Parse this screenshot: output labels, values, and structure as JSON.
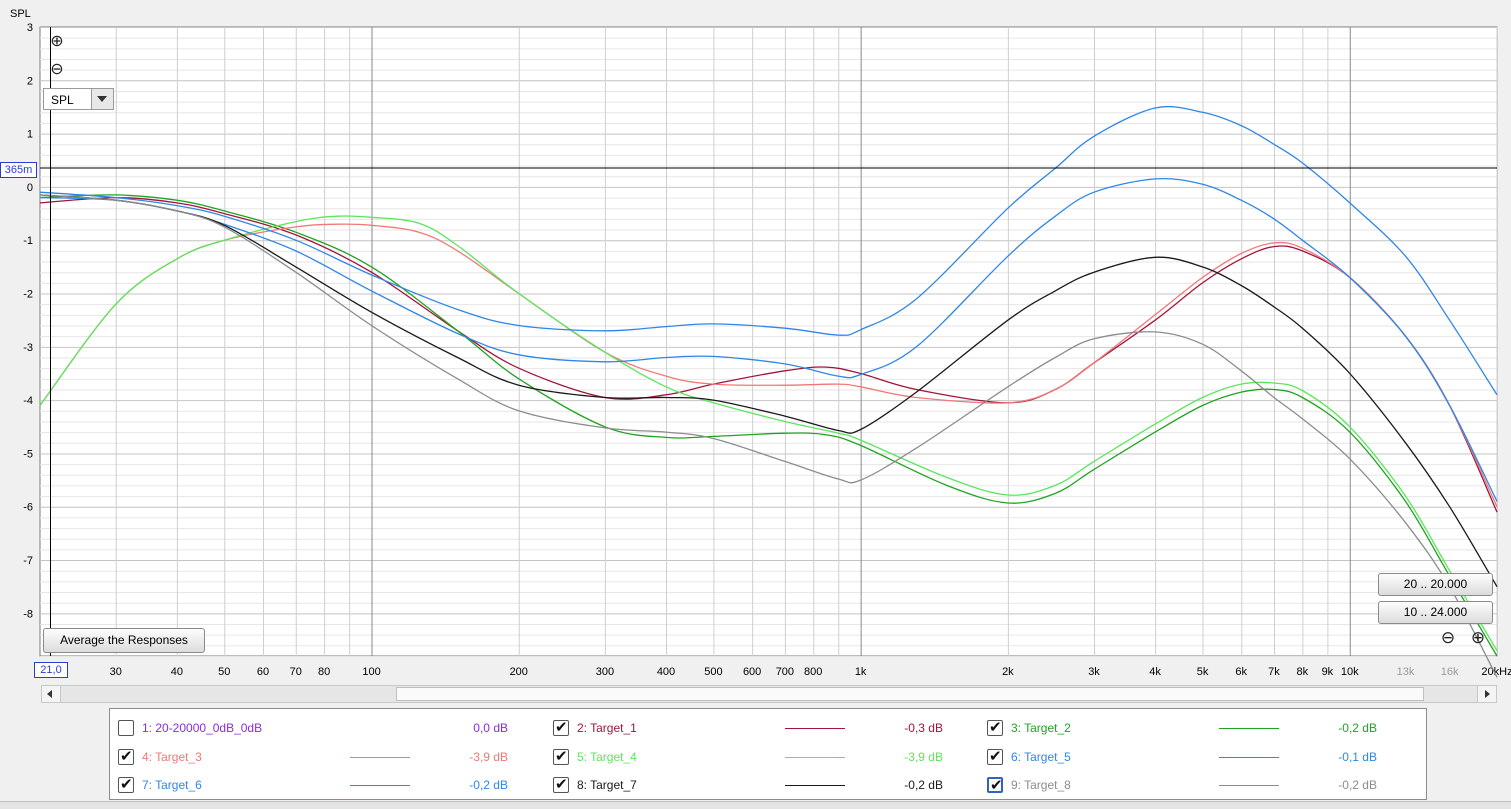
{
  "chart_data": {
    "type": "line",
    "y_axis_label": "SPL",
    "ylim": [
      -8.8,
      3
    ],
    "xlim": [
      21,
      20000
    ],
    "x_scale": "log",
    "grid": true,
    "y_ticks": [
      "3",
      "2",
      "1",
      "0",
      "-1",
      "-2",
      "-3",
      "-4",
      "-5",
      "-6",
      "-7",
      "-8"
    ],
    "x_tick_labels": [
      {
        "f": 30,
        "t": "30"
      },
      {
        "f": 40,
        "t": "40"
      },
      {
        "f": 50,
        "t": "50"
      },
      {
        "f": 60,
        "t": "60"
      },
      {
        "f": 70,
        "t": "70"
      },
      {
        "f": 80,
        "t": "80"
      },
      {
        "f": 100,
        "t": "100"
      },
      {
        "f": 200,
        "t": "200"
      },
      {
        "f": 300,
        "t": "300"
      },
      {
        "f": 400,
        "t": "400"
      },
      {
        "f": 500,
        "t": "500"
      },
      {
        "f": 600,
        "t": "600"
      },
      {
        "f": 700,
        "t": "700"
      },
      {
        "f": 800,
        "t": "800"
      },
      {
        "f": 1000,
        "t": "1k"
      },
      {
        "f": 2000,
        "t": "2k"
      },
      {
        "f": 3000,
        "t": "3k"
      },
      {
        "f": 4000,
        "t": "4k"
      },
      {
        "f": 5000,
        "t": "5k"
      },
      {
        "f": 6000,
        "t": "6k"
      },
      {
        "f": 7000,
        "t": "7k"
      },
      {
        "f": 8000,
        "t": "8k"
      },
      {
        "f": 9000,
        "t": "9k"
      },
      {
        "f": 10000,
        "t": "10k"
      },
      {
        "f": 13000,
        "t": "13k",
        "muted": true
      },
      {
        "f": 16000,
        "t": "16k",
        "muted": true
      },
      {
        "f": 20000,
        "t": "20kHz"
      }
    ],
    "cursor_y_label": "365m",
    "cursor_y_value": 0.365,
    "cursor_x_label": "21,0",
    "series": [
      {
        "name": "Target_1",
        "color": "#a3143a",
        "points": [
          [
            21,
            -0.3
          ],
          [
            30,
            -0.2
          ],
          [
            40,
            -0.3
          ],
          [
            50,
            -0.5
          ],
          [
            70,
            -0.9
          ],
          [
            100,
            -1.6
          ],
          [
            150,
            -2.7
          ],
          [
            200,
            -3.4
          ],
          [
            300,
            -3.95
          ],
          [
            400,
            -3.9
          ],
          [
            500,
            -3.7
          ],
          [
            700,
            -3.45
          ],
          [
            850,
            -3.38
          ],
          [
            1000,
            -3.5
          ],
          [
            1300,
            -3.8
          ],
          [
            2000,
            -4.05
          ],
          [
            2500,
            -3.8
          ],
          [
            3000,
            -3.3
          ],
          [
            4000,
            -2.5
          ],
          [
            5000,
            -1.8
          ],
          [
            6000,
            -1.35
          ],
          [
            7000,
            -1.12
          ],
          [
            8000,
            -1.2
          ],
          [
            10000,
            -1.7
          ],
          [
            13000,
            -2.8
          ],
          [
            16000,
            -4.1
          ],
          [
            20000,
            -6.1
          ]
        ]
      },
      {
        "name": "Target_2",
        "color": "#1fa41f",
        "points": [
          [
            21,
            -0.2
          ],
          [
            30,
            -0.15
          ],
          [
            40,
            -0.25
          ],
          [
            50,
            -0.45
          ],
          [
            70,
            -0.85
          ],
          [
            100,
            -1.5
          ],
          [
            150,
            -2.7
          ],
          [
            200,
            -3.6
          ],
          [
            300,
            -4.5
          ],
          [
            400,
            -4.7
          ],
          [
            500,
            -4.68
          ],
          [
            700,
            -4.62
          ],
          [
            850,
            -4.65
          ],
          [
            1000,
            -4.85
          ],
          [
            1500,
            -5.6
          ],
          [
            2000,
            -5.93
          ],
          [
            2500,
            -5.75
          ],
          [
            3000,
            -5.3
          ],
          [
            4000,
            -4.6
          ],
          [
            5000,
            -4.1
          ],
          [
            6000,
            -3.85
          ],
          [
            7000,
            -3.8
          ],
          [
            8000,
            -3.95
          ],
          [
            10000,
            -4.6
          ],
          [
            13000,
            -5.9
          ],
          [
            16000,
            -7.3
          ],
          [
            20000,
            -8.8
          ]
        ]
      },
      {
        "name": "Target_3",
        "color": "#f07878",
        "points": [
          [
            21,
            -4.1
          ],
          [
            30,
            -2.2
          ],
          [
            40,
            -1.35
          ],
          [
            50,
            -1.0
          ],
          [
            70,
            -0.75
          ],
          [
            85,
            -0.7
          ],
          [
            100,
            -0.72
          ],
          [
            125,
            -0.85
          ],
          [
            150,
            -1.2
          ],
          [
            200,
            -2.0
          ],
          [
            300,
            -3.1
          ],
          [
            400,
            -3.55
          ],
          [
            500,
            -3.7
          ],
          [
            700,
            -3.72
          ],
          [
            900,
            -3.7
          ],
          [
            1000,
            -3.75
          ],
          [
            1300,
            -3.95
          ],
          [
            2000,
            -4.05
          ],
          [
            2500,
            -3.8
          ],
          [
            3000,
            -3.3
          ],
          [
            4000,
            -2.4
          ],
          [
            5000,
            -1.7
          ],
          [
            6000,
            -1.25
          ],
          [
            7000,
            -1.05
          ],
          [
            8000,
            -1.15
          ],
          [
            10000,
            -1.7
          ],
          [
            13000,
            -2.8
          ],
          [
            16000,
            -4.1
          ],
          [
            20000,
            -6.0
          ]
        ]
      },
      {
        "name": "Target_4",
        "color": "#5ce65c",
        "points": [
          [
            21,
            -4.1
          ],
          [
            30,
            -2.2
          ],
          [
            40,
            -1.35
          ],
          [
            50,
            -1.0
          ],
          [
            70,
            -0.65
          ],
          [
            85,
            -0.55
          ],
          [
            100,
            -0.57
          ],
          [
            125,
            -0.68
          ],
          [
            150,
            -1.1
          ],
          [
            200,
            -2.0
          ],
          [
            300,
            -3.1
          ],
          [
            400,
            -3.75
          ],
          [
            500,
            -4.05
          ],
          [
            700,
            -4.4
          ],
          [
            900,
            -4.62
          ],
          [
            1000,
            -4.75
          ],
          [
            1500,
            -5.45
          ],
          [
            2000,
            -5.78
          ],
          [
            2500,
            -5.6
          ],
          [
            3000,
            -5.15
          ],
          [
            4000,
            -4.45
          ],
          [
            5000,
            -3.95
          ],
          [
            6000,
            -3.7
          ],
          [
            7000,
            -3.68
          ],
          [
            8000,
            -3.82
          ],
          [
            10000,
            -4.5
          ],
          [
            13000,
            -5.8
          ],
          [
            16000,
            -7.2
          ],
          [
            20000,
            -8.7
          ]
        ]
      },
      {
        "name": "Target_5",
        "color": "#2f86e8",
        "points": [
          [
            21,
            -0.1
          ],
          [
            30,
            -0.2
          ],
          [
            40,
            -0.35
          ],
          [
            50,
            -0.55
          ],
          [
            70,
            -1.0
          ],
          [
            100,
            -1.65
          ],
          [
            150,
            -2.3
          ],
          [
            200,
            -2.6
          ],
          [
            300,
            -2.7
          ],
          [
            400,
            -2.62
          ],
          [
            500,
            -2.57
          ],
          [
            700,
            -2.65
          ],
          [
            900,
            -2.78
          ],
          [
            1000,
            -2.68
          ],
          [
            1300,
            -2.1
          ],
          [
            2000,
            -0.4
          ],
          [
            2500,
            0.35
          ],
          [
            3000,
            0.95
          ],
          [
            4000,
            1.48
          ],
          [
            5000,
            1.4
          ],
          [
            6000,
            1.15
          ],
          [
            7000,
            0.8
          ],
          [
            8000,
            0.45
          ],
          [
            10000,
            -0.3
          ],
          [
            13000,
            -1.3
          ],
          [
            16000,
            -2.5
          ],
          [
            20000,
            -3.9
          ]
        ]
      },
      {
        "name": "Target_6",
        "color": "#2f86e8",
        "points": [
          [
            21,
            -0.2
          ],
          [
            30,
            -0.25
          ],
          [
            40,
            -0.45
          ],
          [
            50,
            -0.7
          ],
          [
            70,
            -1.2
          ],
          [
            100,
            -1.95
          ],
          [
            150,
            -2.75
          ],
          [
            200,
            -3.15
          ],
          [
            300,
            -3.28
          ],
          [
            400,
            -3.2
          ],
          [
            500,
            -3.18
          ],
          [
            700,
            -3.32
          ],
          [
            900,
            -3.55
          ],
          [
            1000,
            -3.52
          ],
          [
            1300,
            -3.0
          ],
          [
            2000,
            -1.3
          ],
          [
            2500,
            -0.55
          ],
          [
            3000,
            -0.1
          ],
          [
            4000,
            0.15
          ],
          [
            5000,
            0.05
          ],
          [
            6000,
            -0.25
          ],
          [
            7000,
            -0.6
          ],
          [
            8000,
            -1.0
          ],
          [
            10000,
            -1.7
          ],
          [
            13000,
            -2.8
          ],
          [
            16000,
            -4.1
          ],
          [
            20000,
            -5.9
          ]
        ]
      },
      {
        "name": "Target_7",
        "color": "#1a1a1a",
        "points": [
          [
            21,
            -0.15
          ],
          [
            30,
            -0.25
          ],
          [
            40,
            -0.45
          ],
          [
            50,
            -0.72
          ],
          [
            70,
            -1.5
          ],
          [
            100,
            -2.35
          ],
          [
            150,
            -3.2
          ],
          [
            200,
            -3.72
          ],
          [
            300,
            -3.95
          ],
          [
            400,
            -3.95
          ],
          [
            500,
            -4.0
          ],
          [
            700,
            -4.3
          ],
          [
            900,
            -4.57
          ],
          [
            1000,
            -4.55
          ],
          [
            1300,
            -3.85
          ],
          [
            2000,
            -2.5
          ],
          [
            2500,
            -1.95
          ],
          [
            3000,
            -1.6
          ],
          [
            4000,
            -1.32
          ],
          [
            5000,
            -1.5
          ],
          [
            6000,
            -1.85
          ],
          [
            7000,
            -2.25
          ],
          [
            8000,
            -2.65
          ],
          [
            10000,
            -3.5
          ],
          [
            13000,
            -4.8
          ],
          [
            16000,
            -6.0
          ],
          [
            20000,
            -7.5
          ]
        ]
      },
      {
        "name": "Target_8",
        "color": "#8c8c8c",
        "points": [
          [
            21,
            -0.15
          ],
          [
            30,
            -0.25
          ],
          [
            40,
            -0.45
          ],
          [
            50,
            -0.75
          ],
          [
            70,
            -1.6
          ],
          [
            100,
            -2.6
          ],
          [
            150,
            -3.6
          ],
          [
            200,
            -4.2
          ],
          [
            300,
            -4.52
          ],
          [
            400,
            -4.6
          ],
          [
            500,
            -4.72
          ],
          [
            700,
            -5.15
          ],
          [
            900,
            -5.48
          ],
          [
            1000,
            -5.5
          ],
          [
            1300,
            -4.9
          ],
          [
            2000,
            -3.75
          ],
          [
            2500,
            -3.2
          ],
          [
            3000,
            -2.85
          ],
          [
            4000,
            -2.72
          ],
          [
            5000,
            -2.95
          ],
          [
            6000,
            -3.45
          ],
          [
            7000,
            -3.95
          ],
          [
            8000,
            -4.35
          ],
          [
            10000,
            -5.1
          ],
          [
            13000,
            -6.3
          ],
          [
            16000,
            -7.5
          ],
          [
            20000,
            -9.2
          ]
        ]
      }
    ]
  },
  "controls": {
    "spl_select": "SPL",
    "average_button": "Average the Responses",
    "range_20": "20 .. 20.000",
    "range_10": "10 .. 24.000"
  },
  "legend": [
    {
      "label": "1: 20-20000_0dB_0dB",
      "db": "0,0 dB",
      "color": "#8a2be2",
      "checked": false
    },
    {
      "label": "2: Target_1",
      "db": "-0,3 dB",
      "color": "#a3143a",
      "checked": true
    },
    {
      "label": "3: Target_2",
      "db": "-0,2 dB",
      "color": "#1fa41f",
      "checked": true
    },
    {
      "label": "4: Target_3",
      "db": "-3,9 dB",
      "color": "#f07878",
      "checked": true
    },
    {
      "label": "5: Target_4",
      "db": "-3,9 dB",
      "color": "#5ce65c",
      "checked": true
    },
    {
      "label": "6: Target_5",
      "db": "-0,1 dB",
      "color": "#2f86e8",
      "checked": true
    },
    {
      "label": "7: Target_6",
      "db": "-0,2 dB",
      "color": "#2f86e8",
      "checked": true
    },
    {
      "label": "8: Target_7",
      "db": "-0,2 dB",
      "color": "#1a1a1a",
      "checked": true
    },
    {
      "label": "9: Target_8",
      "db": "-0,2 dB",
      "color": "#8c8c8c",
      "checked": true
    }
  ]
}
